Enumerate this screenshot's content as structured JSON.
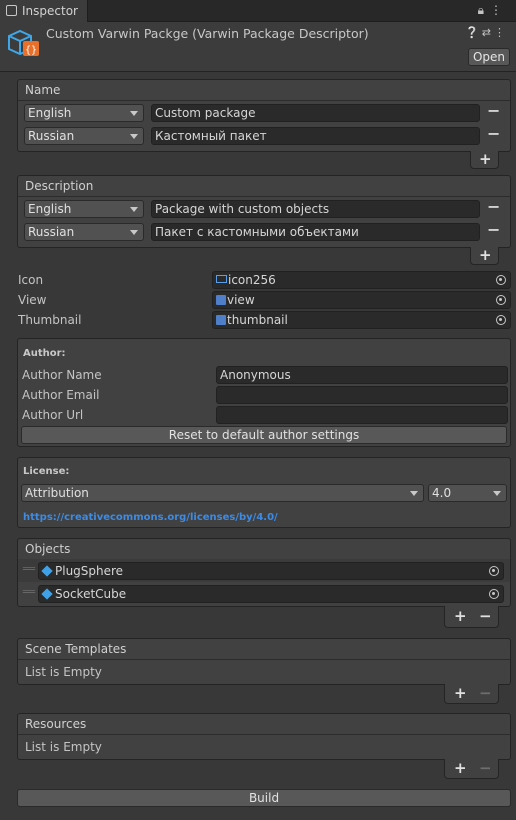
{
  "tab": {
    "title": "Inspector",
    "icons": [
      "lock-icon",
      "menu-icon"
    ]
  },
  "header": {
    "title": "Custom Varwin Packge (Varwin Package Descriptor)",
    "open_label": "Open"
  },
  "name_list": {
    "label": "Name",
    "rows": [
      {
        "language": "English",
        "value": "Custom package"
      },
      {
        "language": "Russian",
        "value": "Кастомный пакет"
      }
    ]
  },
  "description_list": {
    "label": "Description",
    "rows": [
      {
        "language": "English",
        "value": "Package with custom objects"
      },
      {
        "language": "Russian",
        "value": "Пакет с кастомными объектами"
      }
    ]
  },
  "assets": [
    {
      "label": "Icon",
      "value": "icon256"
    },
    {
      "label": "View",
      "value": "view"
    },
    {
      "label": "Thumbnail",
      "value": "thumbnail"
    }
  ],
  "author": {
    "heading": "Author:",
    "name_label": "Author Name",
    "name_value": "Anonymous",
    "email_label": "Author Email",
    "email_value": "",
    "url_label": "Author Url",
    "url_value": "",
    "reset_label": "Reset to default author settings"
  },
  "license": {
    "heading": "License:",
    "type": "Attribution",
    "version": "4.0",
    "url": "https://creativecommons.org/licenses/by/4.0/"
  },
  "objects": {
    "label": "Objects",
    "items": [
      "PlugSphere",
      "SocketCube"
    ]
  },
  "scene_templates": {
    "label": "Scene Templates",
    "empty_text": "List is Empty"
  },
  "resources": {
    "label": "Resources",
    "empty_text": "List is Empty"
  },
  "build_label": "Build",
  "colors": {
    "background": "#383838",
    "link": "#3c8be5",
    "field": "#2a2a2a"
  }
}
